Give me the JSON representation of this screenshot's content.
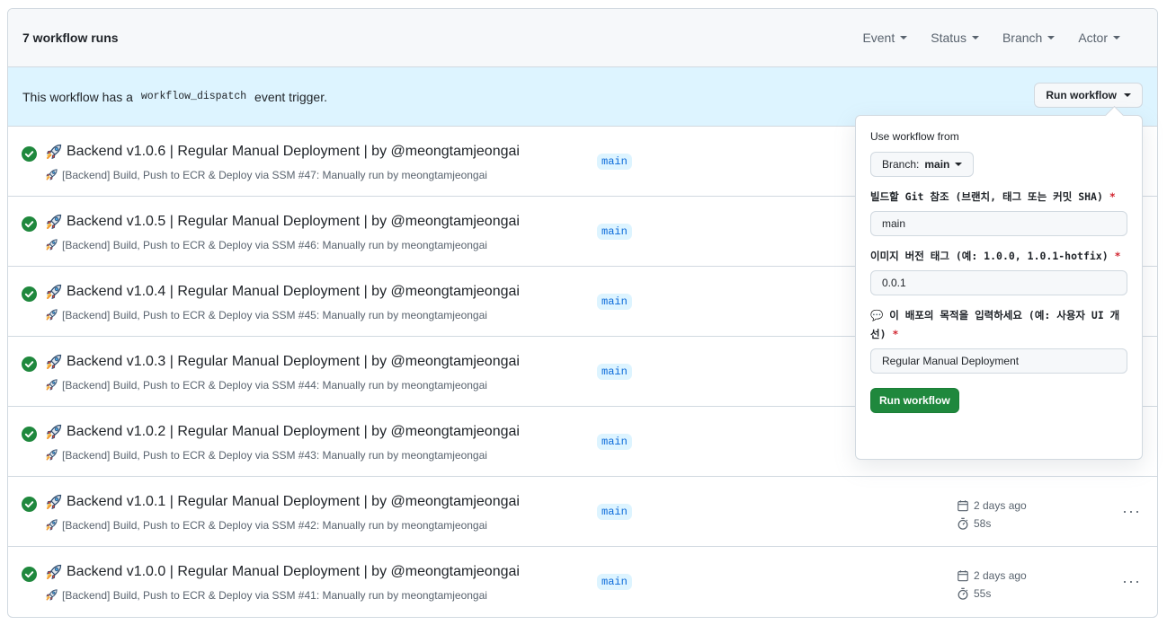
{
  "header": {
    "run_count": "7 workflow runs",
    "filters": [
      "Event",
      "Status",
      "Branch",
      "Actor"
    ]
  },
  "dispatch": {
    "text_before": "This workflow has a",
    "code": "workflow_dispatch",
    "text_after": "event trigger.",
    "button_label": "Run workflow"
  },
  "runs": [
    {
      "title": "Backend v1.0.6 | Regular Manual Deployment | by @meongtamjeongai",
      "workflow": "[Backend] Build, Push to ECR & Deploy via SSM",
      "number": "#47",
      "trigger": ": Manually run by meongtamjeongai",
      "branch": "main",
      "date": "",
      "duration": ""
    },
    {
      "title": "Backend v1.0.5 | Regular Manual Deployment | by @meongtamjeongai",
      "workflow": "[Backend] Build, Push to ECR & Deploy via SSM",
      "number": "#46",
      "trigger": ": Manually run by meongtamjeongai",
      "branch": "main",
      "date": "",
      "duration": ""
    },
    {
      "title": "Backend v1.0.4 | Regular Manual Deployment | by @meongtamjeongai",
      "workflow": "[Backend] Build, Push to ECR & Deploy via SSM",
      "number": "#45",
      "trigger": ": Manually run by meongtamjeongai",
      "branch": "main",
      "date": "",
      "duration": ""
    },
    {
      "title": "Backend v1.0.3 | Regular Manual Deployment | by @meongtamjeongai",
      "workflow": "[Backend] Build, Push to ECR & Deploy via SSM",
      "number": "#44",
      "trigger": ": Manually run by meongtamjeongai",
      "branch": "main",
      "date": "",
      "duration": ""
    },
    {
      "title": "Backend v1.0.2 | Regular Manual Deployment | by @meongtamjeongai",
      "workflow": "[Backend] Build, Push to ECR & Deploy via SSM",
      "number": "#43",
      "trigger": ": Manually run by meongtamjeongai",
      "branch": "main",
      "date": "",
      "duration": ""
    },
    {
      "title": "Backend v1.0.1 | Regular Manual Deployment | by @meongtamjeongai",
      "workflow": "[Backend] Build, Push to ECR & Deploy via SSM",
      "number": "#42",
      "trigger": ": Manually run by meongtamjeongai",
      "branch": "main",
      "date": "2 days ago",
      "duration": "58s"
    },
    {
      "title": "Backend v1.0.0 | Regular Manual Deployment | by @meongtamjeongai",
      "workflow": "[Backend] Build, Push to ECR & Deploy via SSM",
      "number": "#41",
      "trigger": ": Manually run by meongtamjeongai",
      "branch": "main",
      "date": "2 days ago",
      "duration": "55s"
    }
  ],
  "popover": {
    "use_from_label": "Use workflow from",
    "branch_prefix": "Branch:",
    "branch_value": "main",
    "fields": [
      {
        "label": "빌드할 Git 참조 (브랜치, 태그 또는 커밋 SHA)",
        "value": "main"
      },
      {
        "label": "이미지 버전 태그 (예: 1.0.0, 1.0.1-hotfix)",
        "value": "0.0.1"
      },
      {
        "label": "💬 이 배포의 목적을 입력하세요 (예: 사용자 UI 개선)",
        "value": "Regular Manual Deployment"
      }
    ],
    "required_mark": "*",
    "submit_label": "Run workflow"
  },
  "colors": {
    "success": "#1f883d",
    "branch_bg": "#ddf4ff",
    "branch_text": "#0969da",
    "banner_bg": "#ddf4ff"
  },
  "icons": {
    "status": "check-circle-icon",
    "rocket": "rocket-icon",
    "calendar": "calendar-icon",
    "stopwatch": "stopwatch-icon",
    "more": "kebab-horizontal-icon"
  }
}
